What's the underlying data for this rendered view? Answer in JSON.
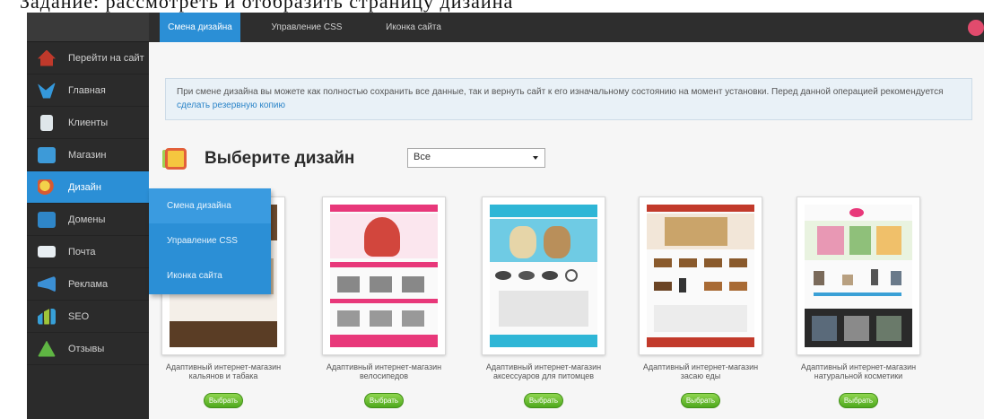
{
  "doc_strip_text": "Задание: рассмотреть и отобразить страницу дизайна",
  "sidebar": {
    "items": [
      {
        "label": "Перейти на сайт",
        "icon": "home-icon"
      },
      {
        "label": "Главная",
        "icon": "bird-icon"
      },
      {
        "label": "Клиенты",
        "icon": "document-icon"
      },
      {
        "label": "Магазин",
        "icon": "cart-icon"
      },
      {
        "label": "Дизайн",
        "icon": "palette-icon"
      },
      {
        "label": "Домены",
        "icon": "domain-icon"
      },
      {
        "label": "Почта",
        "icon": "mail-icon"
      },
      {
        "label": "Реклама",
        "icon": "megaphone-icon"
      },
      {
        "label": "SEO",
        "icon": "bar-chart-icon"
      },
      {
        "label": "Отзывы",
        "icon": "triangle-icon"
      }
    ]
  },
  "topbar": {
    "tabs": [
      {
        "label": "Смена дизайна"
      },
      {
        "label": "Управление CSS"
      },
      {
        "label": "Иконка сайта"
      }
    ]
  },
  "flyout": {
    "items": [
      {
        "label": "Смена дизайна"
      },
      {
        "label": "Управление CSS"
      },
      {
        "label": "Иконка сайта"
      }
    ]
  },
  "info": {
    "text": "При смене дизайна вы можете как полностью сохранить все данные, так и вернуть сайт к его изначальному состоянию на момент установки. Перед данной операцией рекомендуется",
    "link": "сделать резервную копию"
  },
  "main": {
    "heading": "Выберите дизайн",
    "filter_value": "Все"
  },
  "cards": [
    {
      "caption": "Адаптивный интернет-магазин кальянов и табака",
      "button": "Выбрать"
    },
    {
      "caption": "Адаптивный интернет-магазин велосипедов",
      "button": "Выбрать"
    },
    {
      "caption": "Адаптивный интернет-магазин аксессуаров для питомцев",
      "button": "Выбрать"
    },
    {
      "caption": "Адаптивный интернет-магазин засаю еды",
      "button": "Выбрать"
    },
    {
      "caption": "Адаптивный интернет-магазин натуральной косметики",
      "button": "Выбрать"
    }
  ],
  "colors": {
    "accent": "#2b8fd6",
    "sidebar": "#2b2b2b",
    "button_green": "#5cb82a",
    "info_bg": "#e9f1f7"
  }
}
